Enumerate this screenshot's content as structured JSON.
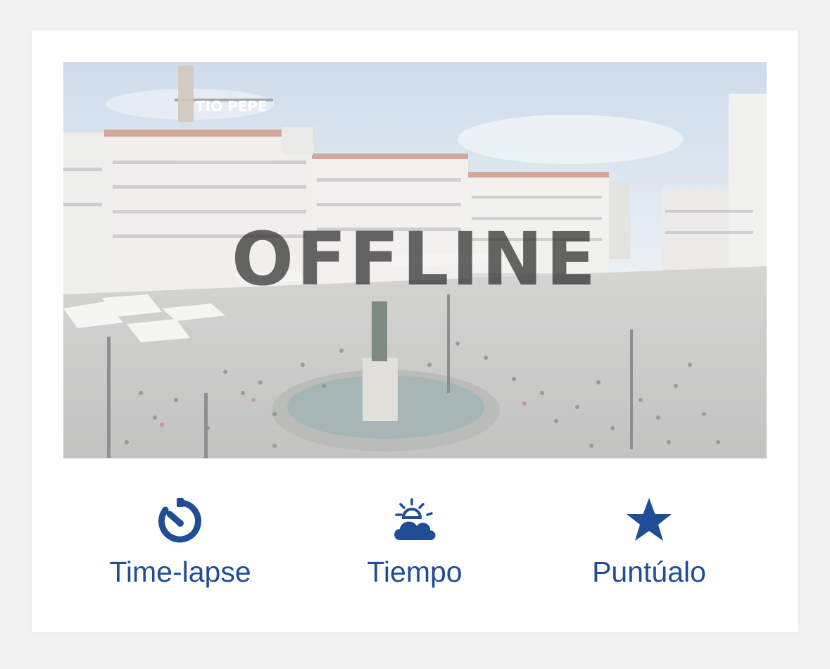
{
  "webcam": {
    "status_text": "OFFLINE",
    "sign_text": "TIO PEPE"
  },
  "actions": [
    {
      "label": "Time-lapse",
      "icon": "timer-icon"
    },
    {
      "label": "Tiempo",
      "icon": "weather-sun-cloud-icon"
    },
    {
      "label": "Puntúalo",
      "icon": "star-icon"
    }
  ],
  "colors": {
    "accent": "#1f4e95",
    "card_background": "#ffffff",
    "page_background": "#f2f2f2"
  }
}
